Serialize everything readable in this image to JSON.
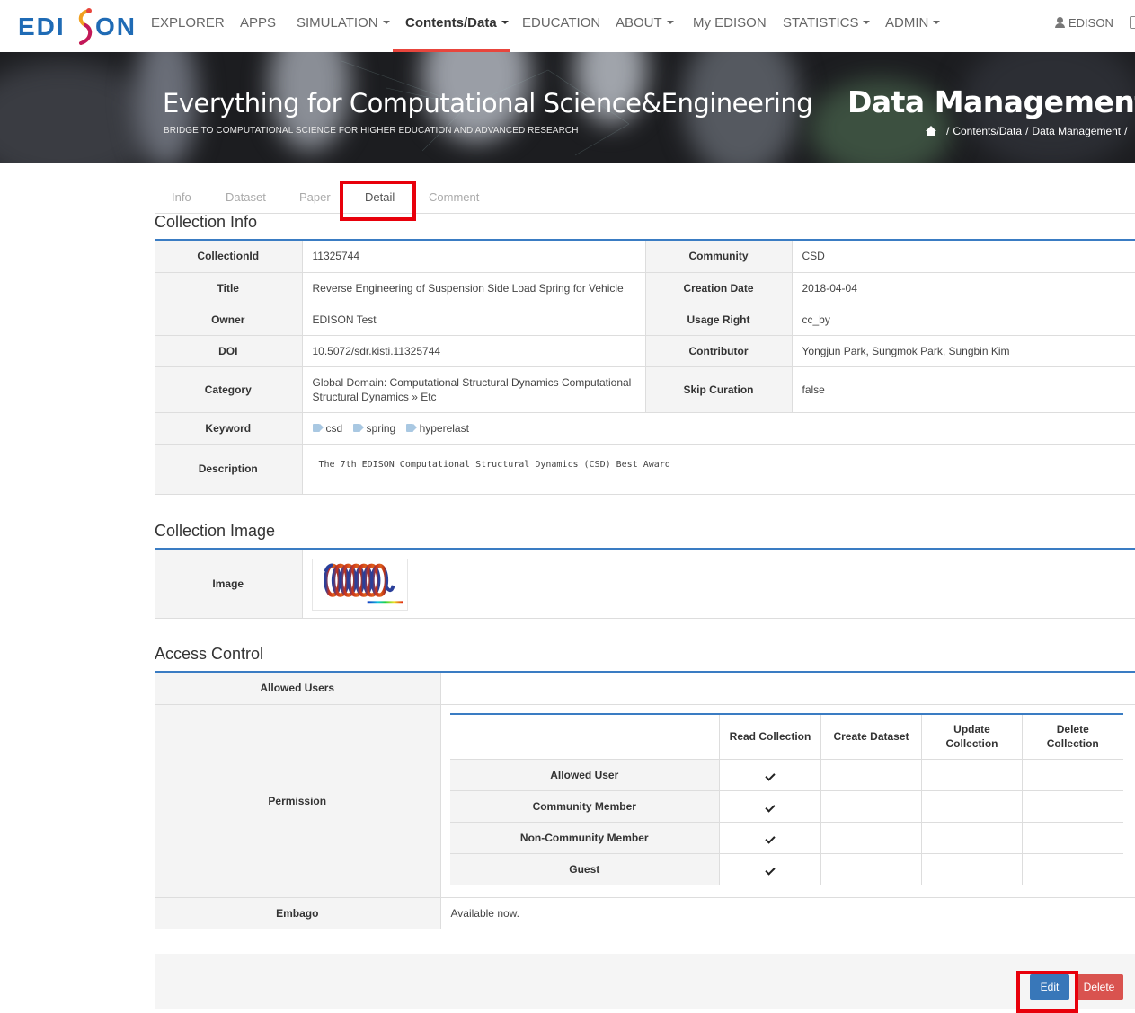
{
  "brand": {
    "logo_text_left": "EDI",
    "logo_text_right": "ON",
    "logo_mark": "S"
  },
  "nav": {
    "items": [
      {
        "label": "EXPLORER",
        "dropdown": false
      },
      {
        "label": "APPS",
        "dropdown": false
      },
      {
        "label": "SIMULATION",
        "dropdown": true
      },
      {
        "label": "Contents/Data",
        "dropdown": true,
        "active": true
      },
      {
        "label": "EDUCATION",
        "dropdown": false
      },
      {
        "label": "ABOUT",
        "dropdown": true
      },
      {
        "label": "My EDISON",
        "dropdown": false
      },
      {
        "label": "STATISTICS",
        "dropdown": true
      },
      {
        "label": "ADMIN",
        "dropdown": true
      }
    ],
    "user": "EDISON",
    "accent_color": "#e8453c"
  },
  "banner": {
    "title": "Everything for Computational Science&Engineering",
    "subtitle": "BRIDGE TO COMPUTATIONAL SCIENCE FOR HIGHER EDUCATION AND ADVANCED RESEARCH",
    "page_heading": "Data Management",
    "breadcrumb": [
      "Contents/Data",
      "Data Management"
    ]
  },
  "tabs": [
    {
      "label": "Info"
    },
    {
      "label": "Dataset"
    },
    {
      "label": "Paper"
    },
    {
      "label": "Detail",
      "active": true
    },
    {
      "label": "Comment"
    }
  ],
  "collection_info": {
    "title": "Collection Info",
    "labels": {
      "collection_id": "CollectionId",
      "community": "Community",
      "title": "Title",
      "creation_date": "Creation Date",
      "owner": "Owner",
      "usage_right": "Usage Right",
      "doi": "DOI",
      "contributor": "Contributor",
      "category": "Category",
      "skip_curation": "Skip Curation",
      "keyword": "Keyword",
      "description": "Description"
    },
    "values": {
      "collection_id": "11325744",
      "community": "CSD",
      "title": "Reverse Engineering of Suspension Side Load Spring for Vehicle",
      "creation_date": "2018-04-04",
      "owner": "EDISON Test",
      "usage_right": "cc_by",
      "doi": "10.5072/sdr.kisti.11325744",
      "contributor": "Yongjun Park, Sungmok Park, Sungbin Kim",
      "category": "Global Domain: Computational Structural Dynamics   Computational Structural Dynamics » Etc",
      "skip_curation": "false",
      "keywords": [
        "csd",
        "spring",
        "hyperelast"
      ],
      "description": "The 7th EDISON Computational Structural Dynamics (CSD) Best Award"
    }
  },
  "collection_image": {
    "title": "Collection Image",
    "label": "Image",
    "image_icon": "spring-render-thumbnail"
  },
  "access_control": {
    "title": "Access Control",
    "allowed_users_label": "Allowed Users",
    "allowed_users_value": "",
    "permission_label": "Permission",
    "permission_columns": [
      "Read Collection",
      "Create Dataset",
      "Update Collection",
      "Delete Collection"
    ],
    "permission_rows": [
      {
        "role": "Allowed User",
        "perms": [
          true,
          false,
          false,
          false
        ]
      },
      {
        "role": "Community Member",
        "perms": [
          true,
          false,
          false,
          false
        ]
      },
      {
        "role": "Non-Community Member",
        "perms": [
          true,
          false,
          false,
          false
        ]
      },
      {
        "role": "Guest",
        "perms": [
          true,
          false,
          false,
          false
        ]
      }
    ],
    "embargo_label": "Embago",
    "embargo_value": "Available now."
  },
  "actions": {
    "edit": "Edit",
    "delete": "Delete",
    "edit_color": "#3877b9",
    "delete_color": "#d9534f"
  }
}
